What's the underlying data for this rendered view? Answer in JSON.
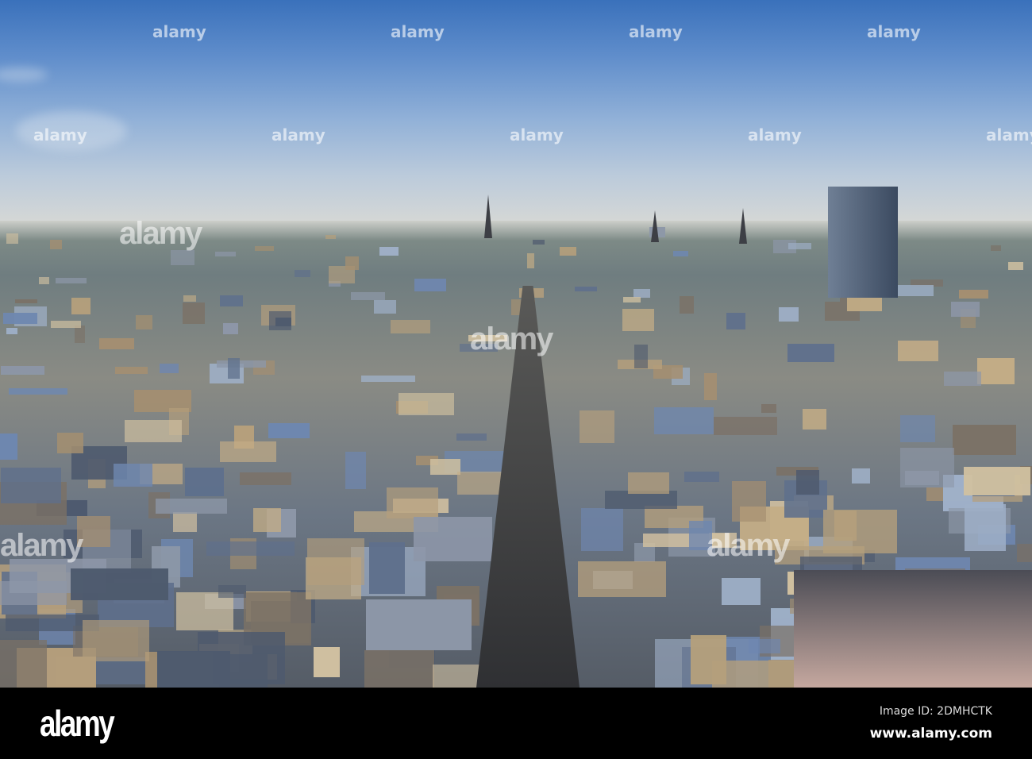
{
  "photo": {
    "subject": "Aerial city view at sunset"
  },
  "watermark": {
    "text": "alamy"
  },
  "footer": {
    "logo": "alamy",
    "image_id": "Image ID: 2DMHCTK",
    "website": "www.alamy.com"
  },
  "colors": {
    "sky_top": "#3a71bb",
    "horizon": "#d4d7d6",
    "footer_bg": "#000000"
  }
}
